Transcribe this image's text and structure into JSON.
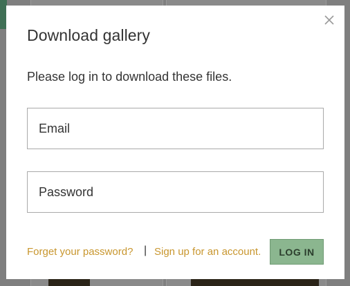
{
  "modal": {
    "title": "Download gallery",
    "message": "Please log in to download these files.",
    "close_icon": "close-icon"
  },
  "form": {
    "email_placeholder": "Email",
    "password_placeholder": "Password"
  },
  "footer": {
    "forgot_link": "Forget your password?",
    "separator": "|",
    "signup_link": "Sign up for an account.",
    "login_label": "LOG IN"
  },
  "colors": {
    "link": "#c8962e",
    "button_bg": "#8bb68f",
    "overlay": "#7f7f7f"
  }
}
